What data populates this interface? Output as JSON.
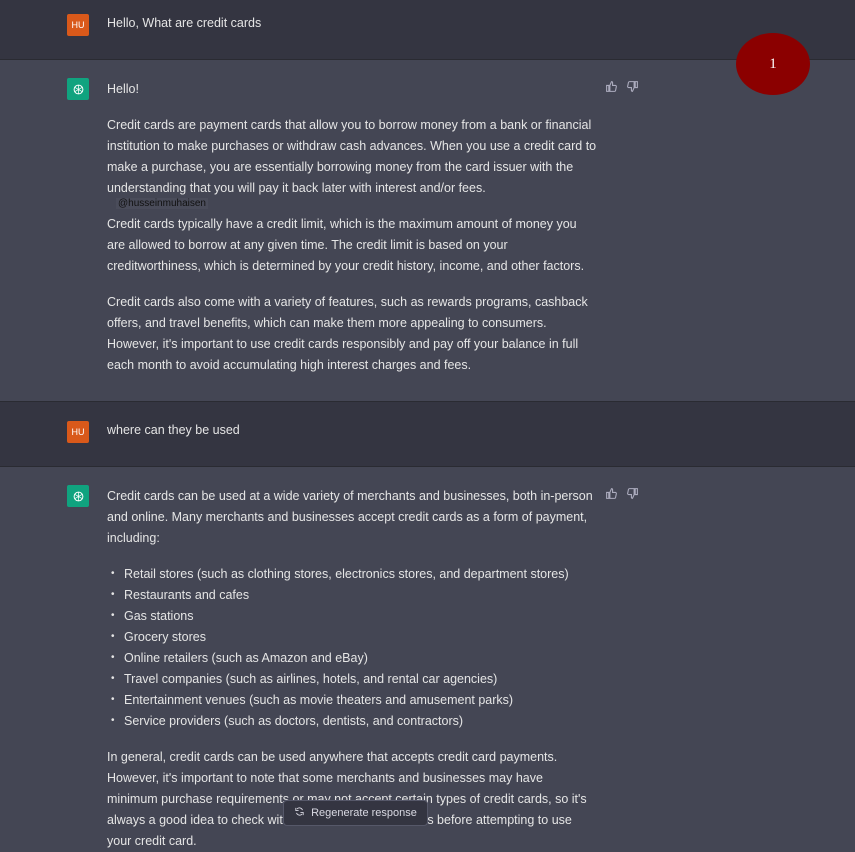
{
  "badge": "1",
  "watermark": "@husseinmuhaisen",
  "conversation": [
    {
      "role": "user",
      "avatar": "HU",
      "text": "Hello, What are credit cards"
    },
    {
      "role": "assistant",
      "paragraphs": [
        "Hello!",
        "Credit cards are payment cards that allow you to borrow money from a bank or financial institution to make purchases or withdraw cash advances. When you use a credit card to make a purchase, you are essentially borrowing money from the card issuer with the understanding that you will pay it back later with interest and/or fees.",
        "Credit cards typically have a credit limit, which is the maximum amount of money you are allowed to borrow at any given time. The credit limit is based on your creditworthiness, which is determined by your credit history, income, and other factors.",
        "Credit cards also come with a variety of features, such as rewards programs, cashback offers, and travel benefits, which can make them more appealing to consumers. However, it's important to use credit cards responsibly and pay off your balance in full each month to avoid accumulating high interest charges and fees."
      ]
    },
    {
      "role": "user",
      "avatar": "HU",
      "text": "where can they be used"
    },
    {
      "role": "assistant",
      "intro": "Credit cards can be used at a wide variety of merchants and businesses, both in-person and online. Many merchants and businesses accept credit cards as a form of payment, including:",
      "items": [
        "Retail stores (such as clothing stores, electronics stores, and department stores)",
        "Restaurants and cafes",
        "Gas stations",
        "Grocery stores",
        "Online retailers (such as Amazon and eBay)",
        "Travel companies (such as airlines, hotels, and rental car agencies)",
        "Entertainment venues (such as movie theaters and amusement parks)",
        "Service providers (such as doctors, dentists, and contractors)"
      ],
      "outro": "In general, credit cards can be used anywhere that accepts credit card payments. However, it's important to note that some merchants and businesses may have minimum purchase requirements or may not accept certain types of credit cards, so it's always a good idea to check with the merchant or business before attempting to use your credit card."
    }
  ],
  "regenerate_label": "Regenerate response"
}
